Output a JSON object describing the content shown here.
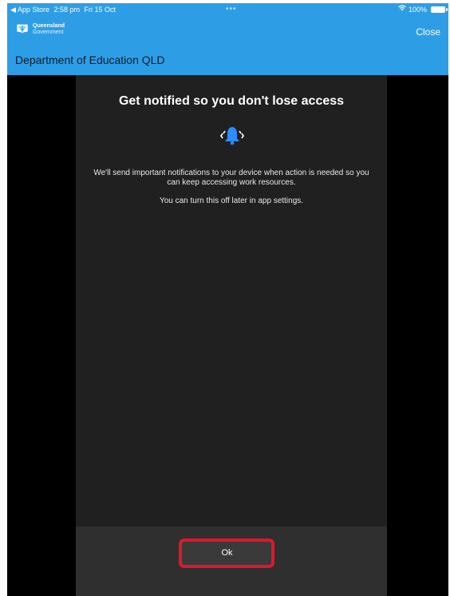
{
  "status_bar": {
    "back_app": "◀ App Store",
    "time": "2:58 pm",
    "date": "Fri 15 Oct",
    "dots": "•••",
    "battery": "100%",
    "wifi_icon": "wifi-icon",
    "battery_icon": "battery-icon"
  },
  "nav": {
    "gov_name": "Queensland",
    "gov_sub": "Government",
    "close_label": "Close"
  },
  "app": {
    "title": "Department of Education QLD"
  },
  "prompt": {
    "heading": "Get notified so you don't lose access",
    "body_1": "We'll send important notifications to your device when action is needed so you can keep accessing work resources.",
    "body_2": "You can turn this off later in app settings.",
    "bell_icon": "bell-icon",
    "ok_label": "Ok"
  },
  "colors": {
    "header": "#2d9ee6",
    "panel": "#202020",
    "footer": "#2f2f2f",
    "highlight": "#e0172e",
    "bell": "#2d8cff"
  }
}
